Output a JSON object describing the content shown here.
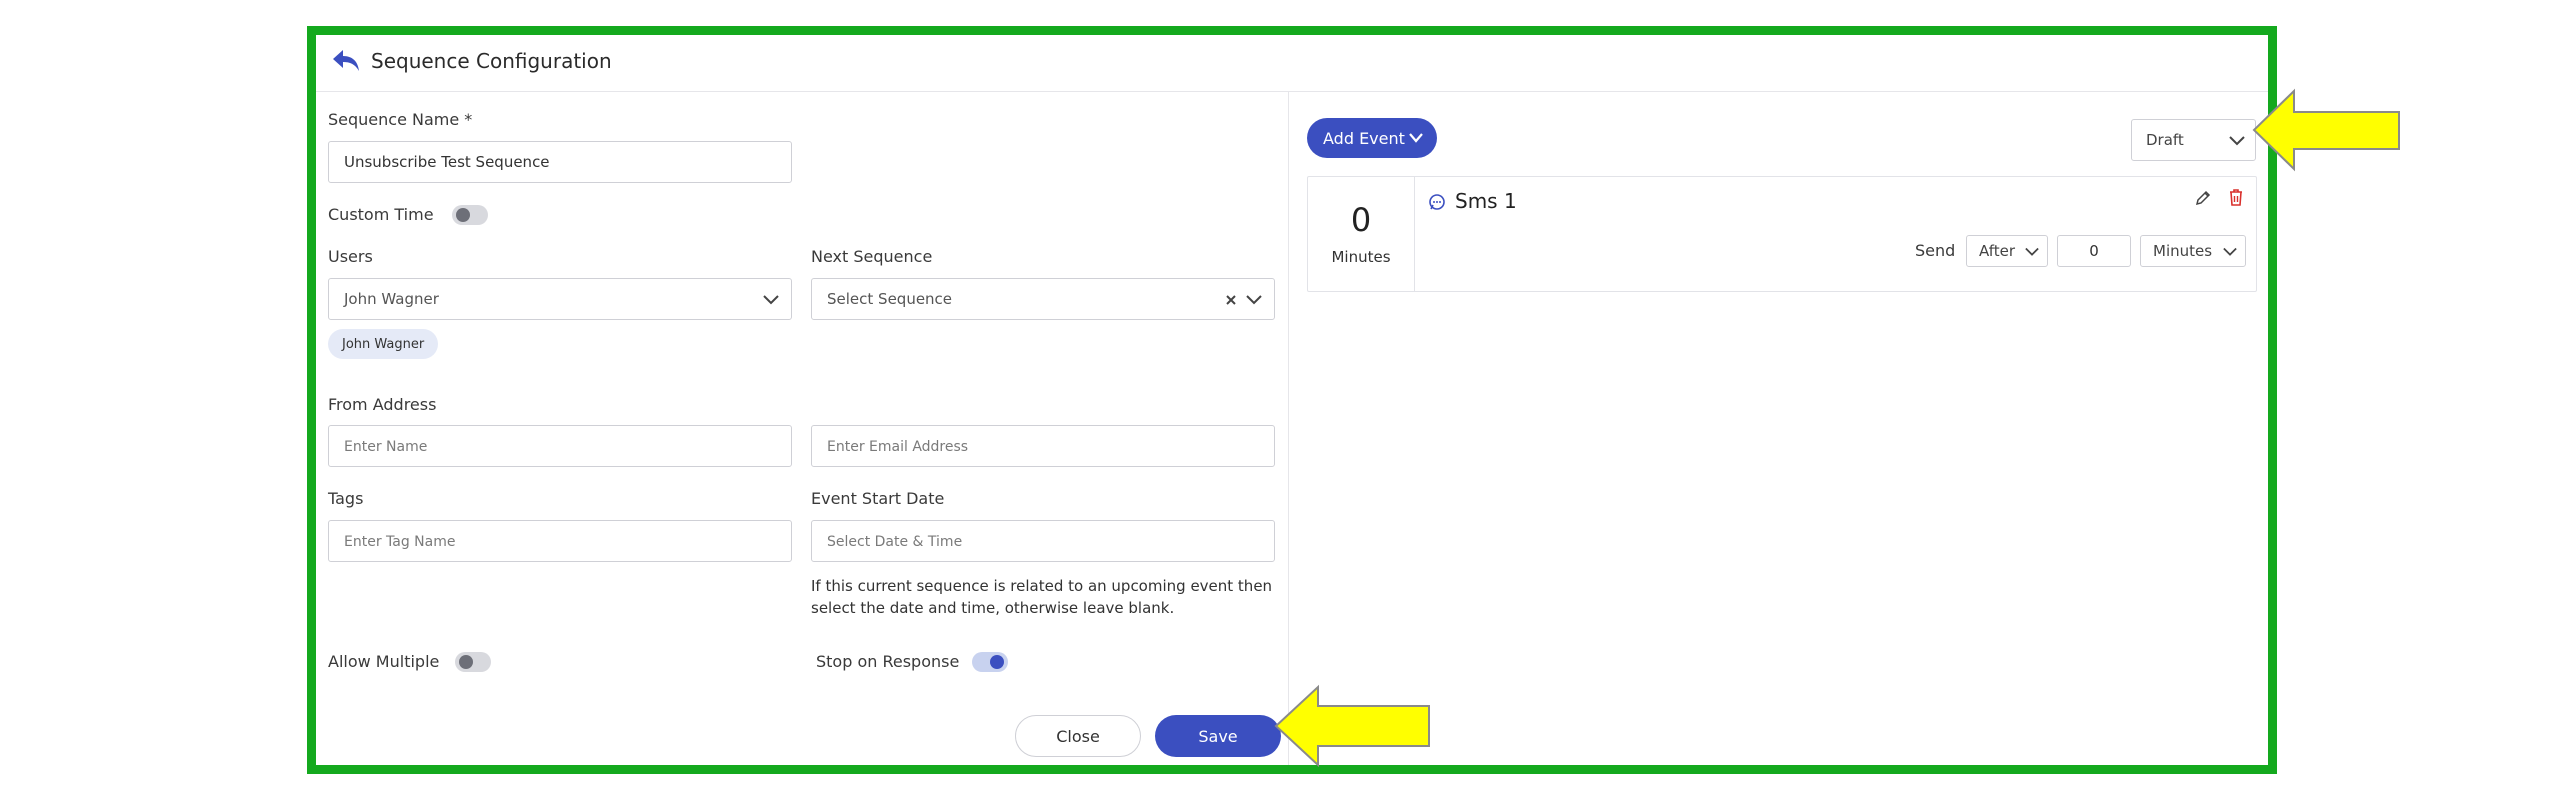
{
  "header": {
    "title": "Sequence Configuration"
  },
  "form": {
    "sequence_name_label": "Sequence Name *",
    "sequence_name_value": "Unsubscribe Test Sequence",
    "custom_time_label": "Custom Time",
    "users_label": "Users",
    "users_selected": "John Wagner",
    "users_chip": "John Wagner",
    "next_sequence_label": "Next Sequence",
    "next_sequence_placeholder": "Select Sequence",
    "from_address_label": "From Address",
    "from_name_placeholder": "Enter Name",
    "from_email_placeholder": "Enter Email Address",
    "tags_label": "Tags",
    "tags_placeholder": "Enter Tag Name",
    "event_start_label": "Event Start Date",
    "event_start_placeholder": "Select Date & Time",
    "event_hint_line1": "If this current sequence is related to an upcoming event then",
    "event_hint_line2": "select the date and time, otherwise leave blank.",
    "allow_multiple_label": "Allow Multiple",
    "stop_on_response_label": "Stop on Response",
    "close_label": "Close",
    "save_label": "Save"
  },
  "events_panel": {
    "add_event_label": "Add Event",
    "status_value": "Draft",
    "event": {
      "count": "0",
      "count_unit": "Minutes",
      "title": "Sms 1",
      "send_label": "Send",
      "timing": "After",
      "amount": "0",
      "unit": "Minutes"
    }
  },
  "colors": {
    "frame_border": "#14a91e",
    "primary": "#3b4fc0",
    "annotation_arrow": "#ffff00",
    "delete": "#d9302c"
  }
}
